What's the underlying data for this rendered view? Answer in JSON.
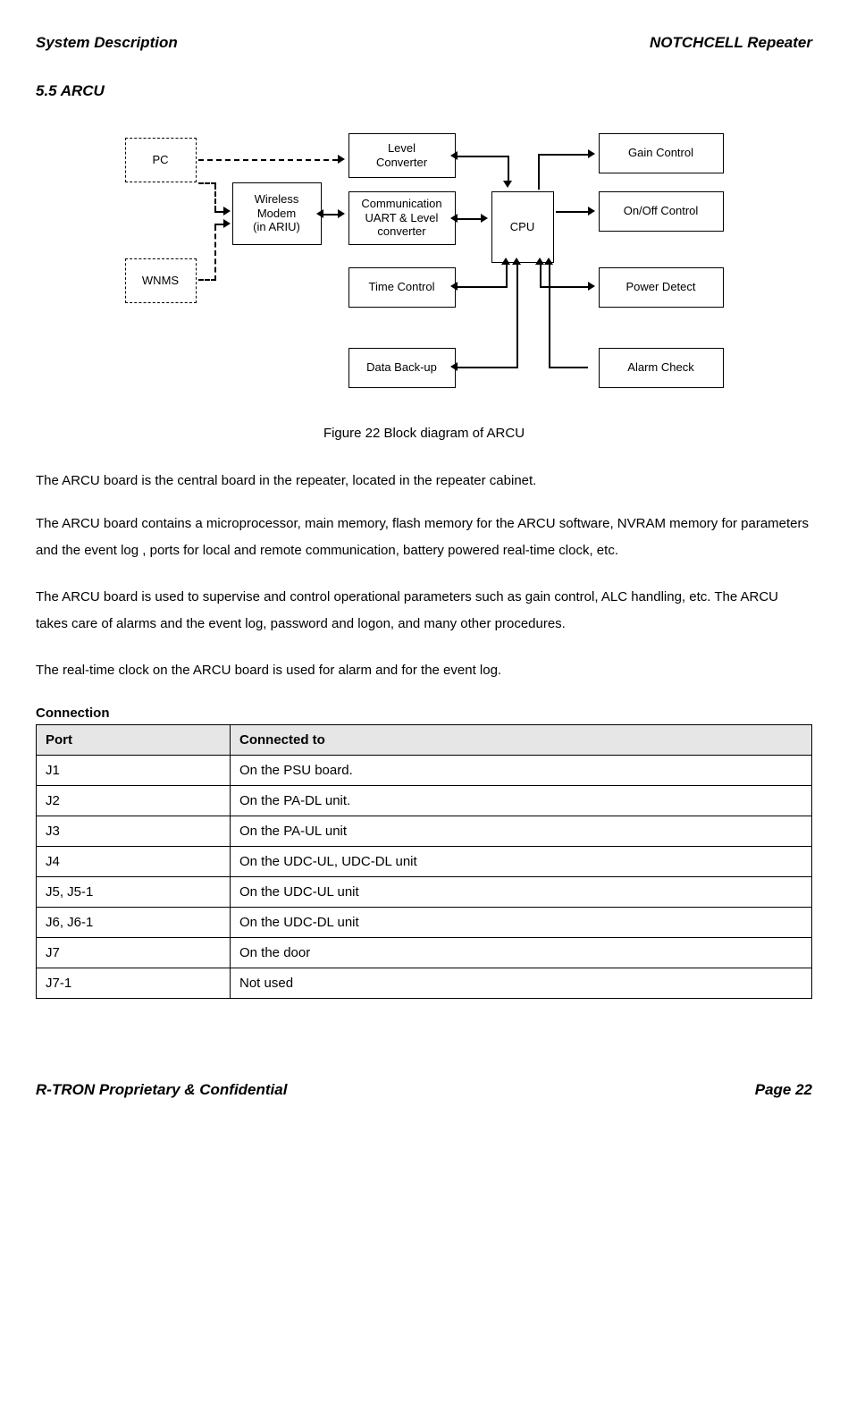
{
  "header": {
    "left": "System Description",
    "right": "NOTCHCELL Repeater"
  },
  "section_heading": "5.5 ARCU",
  "diagram": {
    "pc": "PC",
    "wnms": "WNMS",
    "wireless_modem": "Wireless\nModem\n(in ARIU)",
    "level_converter": "Level\nConverter",
    "comm_uart": "Communication\nUART & Level\nconverter",
    "time_control": "Time Control",
    "data_backup": "Data Back-up",
    "cpu": "CPU",
    "gain_control": "Gain Control",
    "onoff_control": "On/Off Control",
    "power_detect": "Power Detect",
    "alarm_check": "Alarm Check"
  },
  "figure_caption": "Figure 22 Block diagram of ARCU",
  "paragraphs": {
    "p1": "The ARCU board is the central board in the repeater, located in the repeater cabinet.",
    "p2": "The ARCU board contains a microprocessor, main memory, flash memory for the ARCU software, NVRAM memory for parameters and the event log , ports for local and remote communication, battery powered real-time clock, etc.",
    "p3": "The ARCU board is used to supervise and control operational parameters such as gain control, ALC handling, etc. The ARCU takes care of alarms and the event log, password and logon, and many other procedures.",
    "p4": "The real-time clock on the ARCU board is used for alarm and for the event log."
  },
  "connection_heading": "Connection",
  "table": {
    "head_port": "Port",
    "head_conn": "Connected to",
    "rows": [
      {
        "port": "J1",
        "conn": "On the PSU board."
      },
      {
        "port": "J2",
        "conn": "On the PA-DL unit."
      },
      {
        "port": "J3",
        "conn": "On the PA-UL unit"
      },
      {
        "port": "J4",
        "conn": "On the UDC-UL, UDC-DL unit"
      },
      {
        "port": "J5, J5-1",
        "conn": "On the UDC-UL unit"
      },
      {
        "port": "J6, J6-1",
        "conn": "On the UDC-DL unit"
      },
      {
        "port": "J7",
        "conn": "On the door"
      },
      {
        "port": "J7-1",
        "conn": "Not used"
      }
    ]
  },
  "footer": {
    "left": "R-TRON Proprietary & Confidential",
    "right": "Page 22"
  }
}
